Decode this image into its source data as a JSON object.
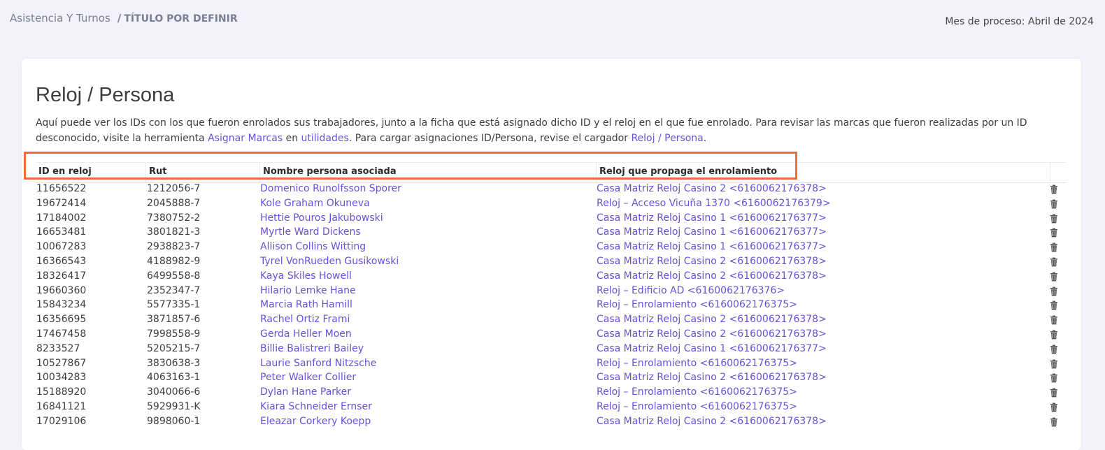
{
  "breadcrumb": {
    "root": "Asistencia Y Turnos",
    "separator": "/",
    "current": "TÍTULO POR DEFINIR"
  },
  "process_month": "Mes de proceso: Abril de 2024",
  "page": {
    "title": "Reloj / Persona",
    "description": {
      "part1": "Aquí puede ver los IDs con los que fueron enrolados sus trabajadores, junto a la ficha que está asignado dicho ID y el reloj en el que fue enrolado. Para revisar las marcas que fueron realizadas por un ID desconocido, visite la herramienta ",
      "link_assign": "Asignar Marcas",
      "part2": " en ",
      "link_utils": "utilidades",
      "part3": ". Para cargar asignaciones ID/Persona, revise el cargador ",
      "link_loader": "Reloj / Persona",
      "part4": "."
    }
  },
  "table": {
    "headers": [
      "ID en reloj",
      "Rut",
      "Nombre persona asociada",
      "Reloj que propaga el enrolamiento"
    ],
    "rows": [
      {
        "id": "11656522",
        "rut": "1212056-7",
        "name": "Domenico Runolfsson Sporer",
        "clock": "Casa Matriz Reloj Casino 2 <6160062176378>"
      },
      {
        "id": "19672414",
        "rut": "2045888-7",
        "name": "Kole Graham Okuneva",
        "clock": "Reloj – Acceso Vicuña 1370 <6160062176379>"
      },
      {
        "id": "17184002",
        "rut": "7380752-2",
        "name": "Hettie Pouros Jakubowski",
        "clock": "Casa Matriz Reloj Casino 1 <6160062176377>"
      },
      {
        "id": "16653481",
        "rut": "3801821-3",
        "name": "Myrtle Ward Dickens",
        "clock": "Casa Matriz Reloj Casino 1 <6160062176377>"
      },
      {
        "id": "10067283",
        "rut": "2938823-7",
        "name": "Allison Collins Witting",
        "clock": "Casa Matriz Reloj Casino 1 <6160062176377>"
      },
      {
        "id": "16366543",
        "rut": "4188982-9",
        "name": "Tyrel VonRueden Gusikowski",
        "clock": "Casa Matriz Reloj Casino 2 <6160062176378>"
      },
      {
        "id": "18326417",
        "rut": "6499558-8",
        "name": "Kaya Skiles Howell",
        "clock": "Casa Matriz Reloj Casino 2 <6160062176378>"
      },
      {
        "id": "19660360",
        "rut": "2352347-7",
        "name": "Hilario Lemke Hane",
        "clock": "Reloj – Edificio AD <6160062176376>"
      },
      {
        "id": "15843234",
        "rut": "5577335-1",
        "name": "Marcia Rath Hamill",
        "clock": "Reloj – Enrolamiento <6160062176375>"
      },
      {
        "id": "16356695",
        "rut": "3871857-6",
        "name": "Rachel Ortiz Frami",
        "clock": "Casa Matriz Reloj Casino 2 <6160062176378>"
      },
      {
        "id": "17467458",
        "rut": "7998558-9",
        "name": "Gerda Heller Moen",
        "clock": "Casa Matriz Reloj Casino 2 <6160062176378>"
      },
      {
        "id": "8233527",
        "rut": "5205215-7",
        "name": "Billie Balistreri Bailey",
        "clock": "Casa Matriz Reloj Casino 1 <6160062176377>"
      },
      {
        "id": "10527867",
        "rut": "3830638-3",
        "name": "Laurie Sanford Nitzsche",
        "clock": "Reloj – Enrolamiento <6160062176375>"
      },
      {
        "id": "10034283",
        "rut": "4063163-1",
        "name": "Peter Walker Collier",
        "clock": "Casa Matriz Reloj Casino 2 <6160062176378>"
      },
      {
        "id": "15188920",
        "rut": "3040066-6",
        "name": "Dylan Hane Parker",
        "clock": "Reloj – Enrolamiento <6160062176375>"
      },
      {
        "id": "16841121",
        "rut": "5929931-K",
        "name": "Kiara Schneider Ernser",
        "clock": "Reloj – Enrolamiento <6160062176375>"
      },
      {
        "id": "17029106",
        "rut": "9898060-1",
        "name": "Eleazar Corkery Koepp",
        "clock": "Casa Matriz Reloj Casino 2 <6160062176378>"
      }
    ],
    "row_action_icon": "trash-icon"
  },
  "colors": {
    "background": "#f3f2fa",
    "link": "#6a4fd8",
    "highlight": "#f26a3d"
  }
}
